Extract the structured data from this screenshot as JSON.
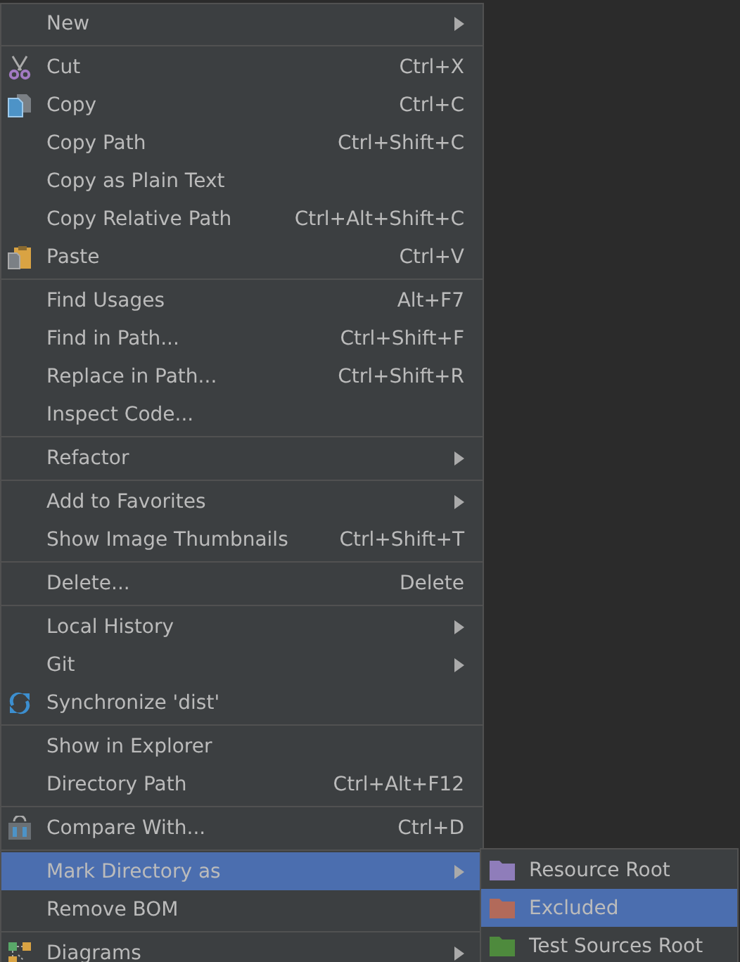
{
  "menu": {
    "groups": [
      [
        {
          "label": "New",
          "has_submenu": true,
          "selected": false
        }
      ],
      [
        {
          "label": "Cut",
          "shortcut": "Ctrl+X",
          "has_submenu": false,
          "selected": false
        },
        {
          "label": "Copy",
          "shortcut": "Ctrl+C",
          "has_submenu": false,
          "selected": false
        },
        {
          "label": "Copy Path",
          "shortcut": "Ctrl+Shift+C",
          "has_submenu": false,
          "selected": false
        },
        {
          "label": "Copy as Plain Text",
          "has_submenu": false,
          "selected": false
        },
        {
          "label": "Copy Relative Path",
          "shortcut": "Ctrl+Alt+Shift+C",
          "has_submenu": false,
          "selected": false
        },
        {
          "label": "Paste",
          "shortcut": "Ctrl+V",
          "has_submenu": false,
          "selected": false
        }
      ],
      [
        {
          "label": "Find Usages",
          "shortcut": "Alt+F7",
          "has_submenu": false,
          "selected": false
        },
        {
          "label": "Find in Path...",
          "shortcut": "Ctrl+Shift+F",
          "has_submenu": false,
          "selected": false
        },
        {
          "label": "Replace in Path...",
          "shortcut": "Ctrl+Shift+R",
          "has_submenu": false,
          "selected": false
        },
        {
          "label": "Inspect Code...",
          "has_submenu": false,
          "selected": false
        }
      ],
      [
        {
          "label": "Refactor",
          "has_submenu": true,
          "selected": false
        }
      ],
      [
        {
          "label": "Add to Favorites",
          "has_submenu": true,
          "selected": false
        },
        {
          "label": "Show Image Thumbnails",
          "shortcut": "Ctrl+Shift+T",
          "has_submenu": false,
          "selected": false
        }
      ],
      [
        {
          "label": "Delete...",
          "shortcut": "Delete",
          "has_submenu": false,
          "selected": false
        }
      ],
      [
        {
          "label": "Local History",
          "has_submenu": true,
          "selected": false
        },
        {
          "label": "Git",
          "has_submenu": true,
          "selected": false
        },
        {
          "label": "Synchronize 'dist'",
          "has_submenu": false,
          "selected": false
        }
      ],
      [
        {
          "label": "Show in Explorer",
          "has_submenu": false,
          "selected": false
        },
        {
          "label": "Directory Path",
          "shortcut": "Ctrl+Alt+F12",
          "has_submenu": false,
          "selected": false
        }
      ],
      [
        {
          "label": "Compare With...",
          "shortcut": "Ctrl+D",
          "has_submenu": false,
          "selected": false
        }
      ],
      [
        {
          "label": "Mark Directory as",
          "has_submenu": true,
          "selected": true
        },
        {
          "label": "Remove BOM",
          "has_submenu": false,
          "selected": false
        }
      ],
      [
        {
          "label": "Diagrams",
          "has_submenu": true,
          "selected": false
        }
      ]
    ]
  },
  "submenu": {
    "items": [
      {
        "label": "Resource Root",
        "color": "#8f7dba",
        "selected": false
      },
      {
        "label": "Excluded",
        "color": "#b26a5a",
        "selected": true
      },
      {
        "label": "Test Sources Root",
        "color": "#4e8a3d",
        "selected": false
      }
    ]
  }
}
